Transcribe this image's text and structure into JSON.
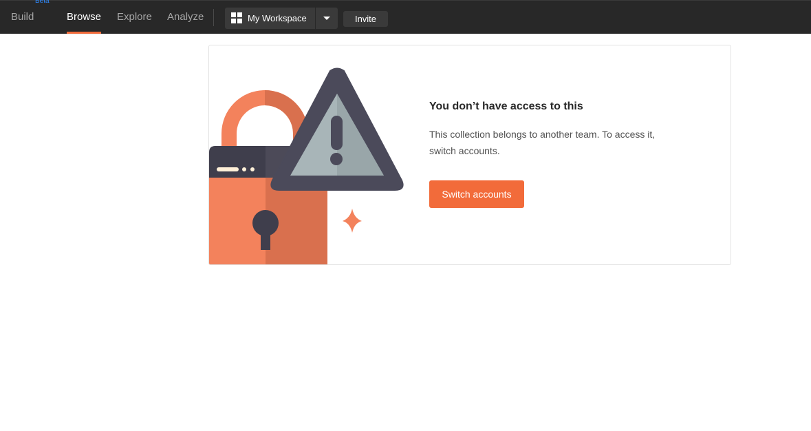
{
  "nav": {
    "items": [
      {
        "label": "Build",
        "badge": "Beta"
      },
      {
        "label": "Browse"
      },
      {
        "label": "Explore"
      },
      {
        "label": "Analyze"
      }
    ],
    "active": "Browse"
  },
  "workspace": {
    "label": "My Workspace",
    "icon": "grid-icon"
  },
  "invite": {
    "label": "Invite"
  },
  "access": {
    "title": "You don’t have access to this",
    "description": "This collection belongs to another team. To access it, switch accounts.",
    "button_label": "Switch accounts"
  },
  "colors": {
    "accent": "#f26b3a",
    "topbar": "#282828",
    "badge": "#2f8bff"
  },
  "icons": [
    "padlock-icon",
    "warning-icon",
    "sparkle-icon",
    "grid-icon",
    "chevron-down-icon"
  ]
}
